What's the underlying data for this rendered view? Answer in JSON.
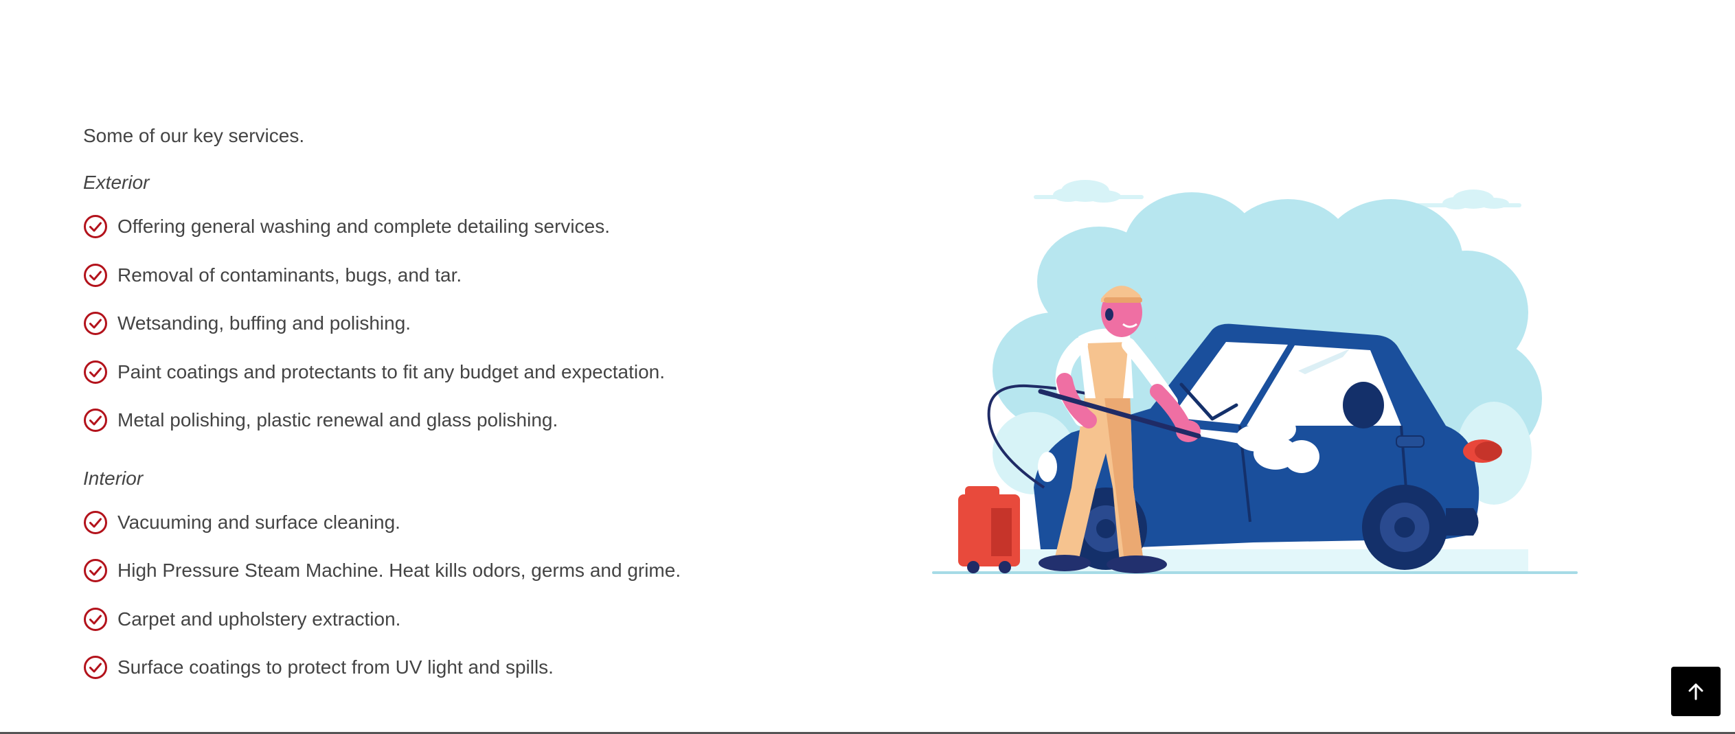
{
  "intro": "Some of our key services.",
  "exterior": {
    "heading": "Exterior",
    "items": [
      "Offering general washing and complete detailing services.",
      "Removal of contaminants, bugs, and tar.",
      "Wetsanding, buffing and polishing.",
      "Paint coatings and protectants to fit any budget and expectation.",
      "Metal polishing, plastic renewal and glass polishing."
    ]
  },
  "interior": {
    "heading": "Interior",
    "items": [
      "Vacuuming and surface cleaning.",
      "High Pressure Steam Machine. Heat kills odors, germs and grime.",
      "Carpet and upholstery extraction.",
      "Surface coatings to protect from UV light and spills."
    ]
  },
  "icons": {
    "check": "check-circle-icon",
    "scroll_top": "arrow-up-icon"
  },
  "colors": {
    "accent": "#b3121b",
    "text": "#444444",
    "car": "#1a4f9c",
    "cloud": "#b7e6ef",
    "scroll_button": "#000000"
  }
}
